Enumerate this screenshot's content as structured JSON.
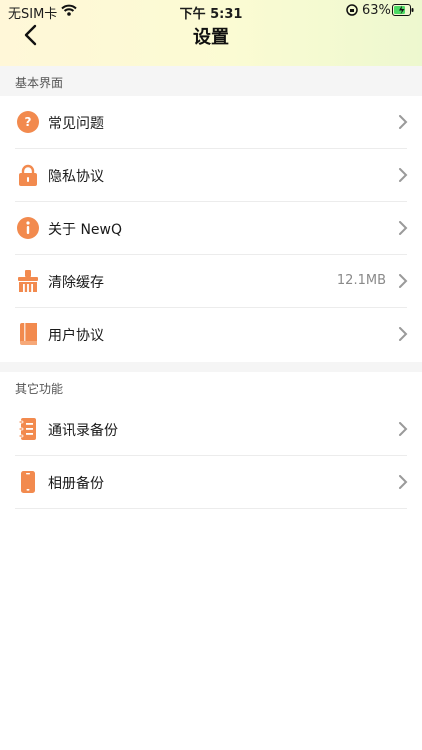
{
  "status_bar": {
    "carrier": "无SIM卡",
    "time": "下午 5:31",
    "battery": "63%"
  },
  "header": {
    "title": "设置"
  },
  "sections": [
    {
      "title": "基本界面",
      "items": [
        {
          "label": "常见问题",
          "icon": "question-icon"
        },
        {
          "label": "隐私协议",
          "icon": "lock-icon"
        },
        {
          "label": "关于 NewQ",
          "icon": "info-icon"
        },
        {
          "label": "清除缓存",
          "icon": "broom-icon",
          "value": "12.1MB"
        },
        {
          "label": "用户协议",
          "icon": "book-icon"
        }
      ]
    },
    {
      "title": "其它功能",
      "items": [
        {
          "label": "通讯录备份",
          "icon": "address-book-icon"
        },
        {
          "label": "相册备份",
          "icon": "phone-icon"
        }
      ]
    }
  ],
  "colors": {
    "accent": "#F28A4E",
    "header_gradient_start": "#FFF7D8",
    "header_gradient_end": "#EDF8CF"
  }
}
